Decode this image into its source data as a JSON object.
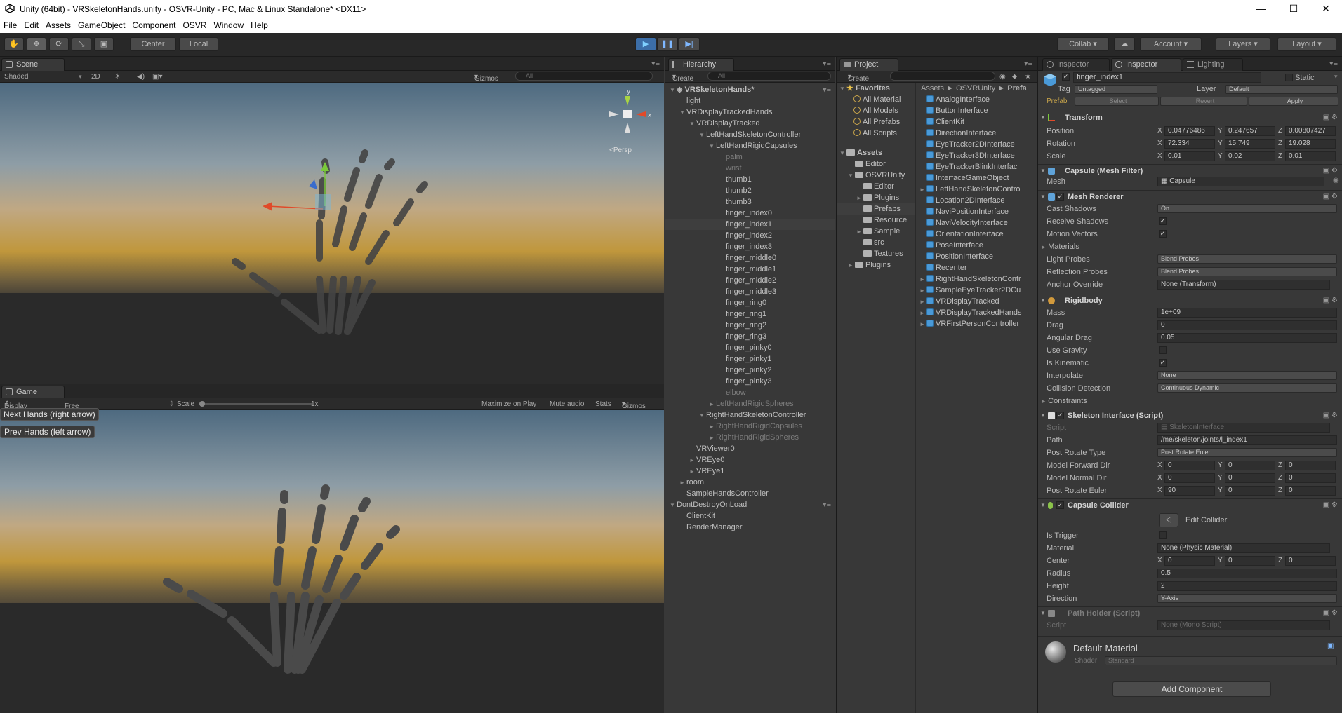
{
  "titlebar": {
    "title": "Unity (64bit) - VRSkeletonHands.unity - OSVR-Unity - PC, Mac & Linux Standalone* <DX11>",
    "minimize": "—",
    "maximize": "☐",
    "close": "✕"
  },
  "menubar": [
    "File",
    "Edit",
    "Assets",
    "GameObject",
    "Component",
    "OSVR",
    "Window",
    "Help"
  ],
  "toolbar": {
    "center": "Center",
    "local": "Local",
    "collab": "Collab",
    "account": "Account",
    "layers": "Layers",
    "layout": "Layout"
  },
  "scene": {
    "tab": "Scene",
    "shaded": "Shaded",
    "mode2d": "2D",
    "gizmos": "Gizmos",
    "search_placeholder": "All",
    "persp": "Persp",
    "gizmo_y": "y",
    "gizmo_x": "x"
  },
  "game": {
    "tab": "Game",
    "display": "Display 1",
    "aspect": "Free Aspect",
    "scale_label": "Scale",
    "scale_value": "1x",
    "maximize": "Maximize on Play",
    "mute": "Mute audio",
    "stats": "Stats",
    "gizmos": "Gizmos",
    "next_button": "Next Hands (right arrow)",
    "prev_button": "Prev Hands (left arrow)"
  },
  "hierarchy": {
    "tab": "Hierarchy",
    "create": "Create",
    "search_placeholder": "All",
    "rows": [
      {
        "t": "VRSkeletonHands*",
        "d": 0,
        "ar": "▼",
        "b": true
      },
      {
        "t": "light",
        "d": 1,
        "ar": ""
      },
      {
        "t": "VRDisplayTrackedHands",
        "d": 1,
        "ar": "▼"
      },
      {
        "t": "VRDisplayTracked",
        "d": 2,
        "ar": "▼"
      },
      {
        "t": "LeftHandSkeletonController",
        "d": 3,
        "ar": "▼"
      },
      {
        "t": "LeftHandRigidCapsules",
        "d": 4,
        "ar": "▼"
      },
      {
        "t": "palm",
        "d": 5,
        "ar": "",
        "dim": true
      },
      {
        "t": "wrist",
        "d": 5,
        "ar": "",
        "dim": true
      },
      {
        "t": "thumb1",
        "d": 5,
        "ar": ""
      },
      {
        "t": "thumb2",
        "d": 5,
        "ar": ""
      },
      {
        "t": "thumb3",
        "d": 5,
        "ar": ""
      },
      {
        "t": "finger_index0",
        "d": 5,
        "ar": ""
      },
      {
        "t": "finger_index1",
        "d": 5,
        "ar": "",
        "sel": true
      },
      {
        "t": "finger_index2",
        "d": 5,
        "ar": ""
      },
      {
        "t": "finger_index3",
        "d": 5,
        "ar": ""
      },
      {
        "t": "finger_middle0",
        "d": 5,
        "ar": ""
      },
      {
        "t": "finger_middle1",
        "d": 5,
        "ar": ""
      },
      {
        "t": "finger_middle2",
        "d": 5,
        "ar": ""
      },
      {
        "t": "finger_middle3",
        "d": 5,
        "ar": ""
      },
      {
        "t": "finger_ring0",
        "d": 5,
        "ar": ""
      },
      {
        "t": "finger_ring1",
        "d": 5,
        "ar": ""
      },
      {
        "t": "finger_ring2",
        "d": 5,
        "ar": ""
      },
      {
        "t": "finger_ring3",
        "d": 5,
        "ar": ""
      },
      {
        "t": "finger_pinky0",
        "d": 5,
        "ar": ""
      },
      {
        "t": "finger_pinky1",
        "d": 5,
        "ar": ""
      },
      {
        "t": "finger_pinky2",
        "d": 5,
        "ar": ""
      },
      {
        "t": "finger_pinky3",
        "d": 5,
        "ar": ""
      },
      {
        "t": "elbow",
        "d": 5,
        "ar": "",
        "dim": true
      },
      {
        "t": "LeftHandRigidSpheres",
        "d": 4,
        "ar": "►",
        "dim": true
      },
      {
        "t": "RightHandSkeletonController",
        "d": 3,
        "ar": "▼"
      },
      {
        "t": "RightHandRigidCapsules",
        "d": 4,
        "ar": "►",
        "dim": true
      },
      {
        "t": "RightHandRigidSpheres",
        "d": 4,
        "ar": "►",
        "dim": true
      },
      {
        "t": "VRViewer0",
        "d": 2,
        "ar": ""
      },
      {
        "t": "VREye0",
        "d": 2,
        "ar": "►"
      },
      {
        "t": "VREye1",
        "d": 2,
        "ar": "►"
      },
      {
        "t": "room",
        "d": 1,
        "ar": "►"
      },
      {
        "t": "SampleHandsController",
        "d": 1,
        "ar": ""
      },
      {
        "t": "DontDestroyOnLoad",
        "d": 0,
        "ar": "▼"
      },
      {
        "t": "ClientKit",
        "d": 1,
        "ar": ""
      },
      {
        "t": "RenderManager",
        "d": 1,
        "ar": ""
      }
    ]
  },
  "project": {
    "tab": "Project",
    "create": "Create",
    "breadcrumb": [
      "Assets",
      "OSVRUnity",
      "Prefa"
    ],
    "favorites_label": "Favorites",
    "favorites": [
      "All Material",
      "All Models",
      "All Prefabs",
      "All Scripts"
    ],
    "assets_label": "Assets",
    "folders": [
      {
        "t": "Editor",
        "d": 1,
        "ar": ""
      },
      {
        "t": "OSVRUnity",
        "d": 1,
        "ar": "▼"
      },
      {
        "t": "Editor",
        "d": 2,
        "ar": ""
      },
      {
        "t": "Plugins",
        "d": 2,
        "ar": "►"
      },
      {
        "t": "Prefabs",
        "d": 2,
        "ar": "",
        "sel": true
      },
      {
        "t": "Resource",
        "d": 2,
        "ar": ""
      },
      {
        "t": "Sample",
        "d": 2,
        "ar": "►"
      },
      {
        "t": "src",
        "d": 2,
        "ar": ""
      },
      {
        "t": "Textures",
        "d": 2,
        "ar": ""
      },
      {
        "t": "Plugins",
        "d": 1,
        "ar": "►"
      }
    ],
    "files": [
      {
        "t": "AnalogInterface",
        "ar": ""
      },
      {
        "t": "ButtonInterface",
        "ar": ""
      },
      {
        "t": "ClientKit",
        "ar": ""
      },
      {
        "t": "DirectionInterface",
        "ar": ""
      },
      {
        "t": "EyeTracker2DInterface",
        "ar": ""
      },
      {
        "t": "EyeTracker3DInterface",
        "ar": ""
      },
      {
        "t": "EyeTrackerBlinkInterfac",
        "ar": ""
      },
      {
        "t": "InterfaceGameObject",
        "ar": ""
      },
      {
        "t": "LeftHandSkeletonContro",
        "ar": "►"
      },
      {
        "t": "Location2DInterface",
        "ar": ""
      },
      {
        "t": "NaviPositionInterface",
        "ar": ""
      },
      {
        "t": "NaviVelocityInterface",
        "ar": ""
      },
      {
        "t": "OrientationInterface",
        "ar": ""
      },
      {
        "t": "PoseInterface",
        "ar": ""
      },
      {
        "t": "PositionInterface",
        "ar": ""
      },
      {
        "t": "Recenter",
        "ar": ""
      },
      {
        "t": "RightHandSkeletonContr",
        "ar": "►"
      },
      {
        "t": "SampleEyeTracker2DCu",
        "ar": "►"
      },
      {
        "t": "VRDisplayTracked",
        "ar": "►"
      },
      {
        "t": "VRDisplayTrackedHands",
        "ar": "►"
      },
      {
        "t": "VRFirstPersonController",
        "ar": "►"
      }
    ]
  },
  "inspector": {
    "tab1": "Inspector",
    "tab2": "Inspector",
    "tab3": "Lighting",
    "name": "finger_index1",
    "static": "Static",
    "tag_label": "Tag",
    "tag": "Untagged",
    "layer_label": "Layer",
    "layer": "Default",
    "prefab_label": "Prefab",
    "select": "Select",
    "revert": "Revert",
    "apply": "Apply",
    "transform": {
      "title": "Transform",
      "position_label": "Position",
      "rotation_label": "Rotation",
      "scale_label": "Scale",
      "position": [
        "0.04776486",
        "0.247657",
        "0.00807427"
      ],
      "rotation": [
        "72.334",
        "15.749",
        "19.028"
      ],
      "scale": [
        "0.01",
        "0.02",
        "0.01"
      ]
    },
    "meshfilter": {
      "title": "Capsule (Mesh Filter)",
      "mesh_label": "Mesh",
      "mesh": "Capsule"
    },
    "meshrenderer": {
      "title": "Mesh Renderer",
      "cast_label": "Cast Shadows",
      "cast": "On",
      "receive_label": "Receive Shadows",
      "motion_label": "Motion Vectors",
      "materials_label": "Materials",
      "lightprobes_label": "Light Probes",
      "lightprobes": "Blend Probes",
      "reflprobes_label": "Reflection Probes",
      "reflprobes": "Blend Probes",
      "anchor_label": "Anchor Override",
      "anchor": "None (Transform)"
    },
    "rigidbody": {
      "title": "Rigidbody",
      "mass_label": "Mass",
      "mass": "1e+09",
      "drag_label": "Drag",
      "drag": "0",
      "adrag_label": "Angular Drag",
      "adrag": "0.05",
      "gravity_label": "Use Gravity",
      "kinematic_label": "Is Kinematic",
      "interp_label": "Interpolate",
      "interp": "None",
      "coll_label": "Collision Detection",
      "coll": "Continuous Dynamic",
      "constraints_label": "Constraints"
    },
    "skeleton": {
      "title": "Skeleton Interface (Script)",
      "script_label": "Script",
      "script": "SkeletonInterface",
      "path_label": "Path",
      "path": "/me/skeleton/joints/l_index1",
      "prt_label": "Post Rotate Type",
      "prt": "Post Rotate Euler",
      "mfd_label": "Model Forward Dir",
      "mfd": [
        "0",
        "0",
        "0"
      ],
      "mnd_label": "Model Normal Dir",
      "mnd": [
        "0",
        "0",
        "0"
      ],
      "pre_label": "Post Rotate Euler",
      "pre": [
        "90",
        "0",
        "0"
      ]
    },
    "collider": {
      "title": "Capsule Collider",
      "edit": "Edit Collider",
      "trigger_label": "Is Trigger",
      "material_label": "Material",
      "material": "None (Physic Material)",
      "center_label": "Center",
      "center": [
        "0",
        "0",
        "0"
      ],
      "radius_label": "Radius",
      "radius": "0.5",
      "height_label": "Height",
      "height": "2",
      "direction_label": "Direction",
      "direction": "Y-Axis"
    },
    "pathholder": {
      "title": "Path Holder (Script)",
      "script_label": "Script",
      "script": "None (Mono Script)"
    },
    "material": {
      "name": "Default-Material",
      "shader_label": "Shader",
      "shader": "Standard"
    },
    "add_component": "Add Component"
  }
}
